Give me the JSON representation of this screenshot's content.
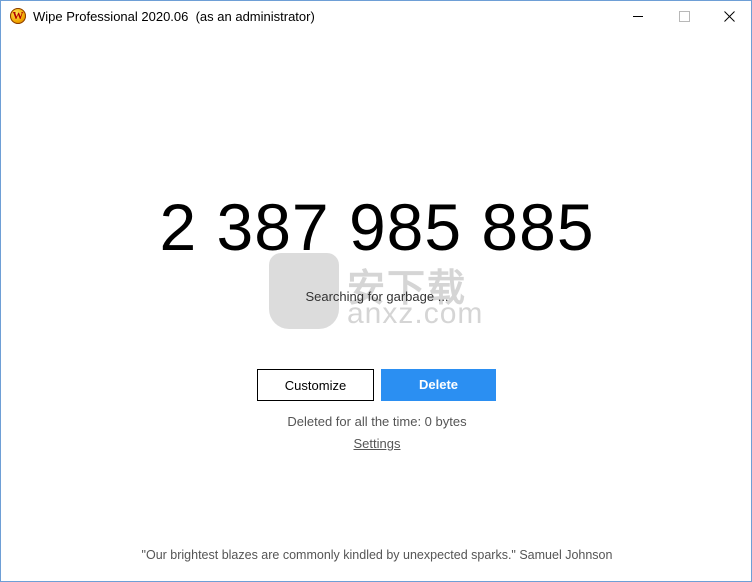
{
  "window": {
    "title": "Wipe Professional 2020.06  (as an administrator)",
    "app_icon_letter": "W"
  },
  "main": {
    "counter": "2 387 985 885",
    "status": "Searching for garbage ...",
    "customize_label": "Customize",
    "delete_label": "Delete",
    "deleted_info": "Deleted for all the time: 0 bytes",
    "settings_label": "Settings",
    "quote": "\"Our brightest blazes are commonly kindled by unexpected sparks.\" Samuel Johnson"
  },
  "watermark": {
    "text_cn": "安下载",
    "text_en": "anxz.com"
  },
  "colors": {
    "accent": "#2b8ff2",
    "border": "#6e9fd6"
  },
  "icons": [
    "app-icon",
    "minimize-icon",
    "maximize-icon",
    "close-icon"
  ]
}
